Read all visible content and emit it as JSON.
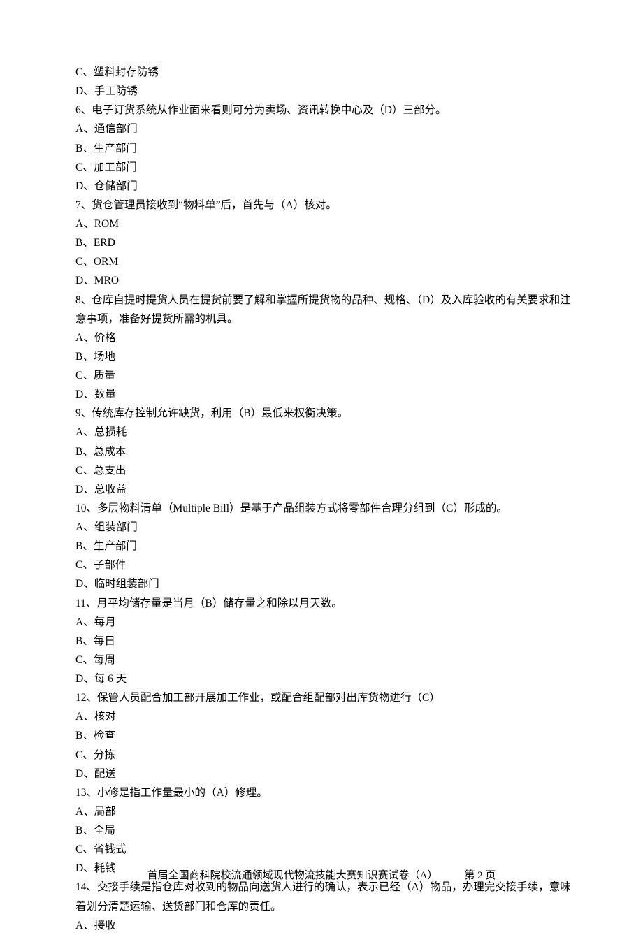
{
  "lines": {
    "l0": "C、塑料封存防锈",
    "l1": "D、手工防锈",
    "l2": "6、电子订货系统从作业面来看则可分为卖场、资讯转换中心及（D）三部分。",
    "l3": "A、通信部门",
    "l4": "B、生产部门",
    "l5": "C、加工部门",
    "l6": "D、仓储部门",
    "l7": "7、货仓管理员接收到“物料单”后，首先与（A）核对。",
    "l8": "A、ROM",
    "l9": "B、ERD",
    "l10": "C、ORM",
    "l11": "D、MRO",
    "l12": "8、仓库自提时提货人员在提货前要了解和掌握所提货物的品种、规格、（D）及入库验收的有关要求和注意事项，准备好提货所需的机具。",
    "l13": "A、价格",
    "l14": "B、场地",
    "l15": "C、质量",
    "l16": "D、数量",
    "l17": "9、传统库存控制允许缺货，利用（B）最低来权衡决策。",
    "l18": "A、总损耗",
    "l19": "B、总成本",
    "l20": "C、总支出",
    "l21": "D、总收益",
    "l22": "10、多层物料清单（Multiple Bill）是基于产品组装方式将零部件合理分组到（C）形成的。",
    "l23": "A、组装部门",
    "l24": "B、生产部门",
    "l25": "C、子部件",
    "l26": "D、临时组装部门",
    "l27": "11、月平均储存量是当月（B）储存量之和除以月天数。",
    "l28": "A、每月",
    "l29": "B、每日",
    "l30": "C、每周",
    "l31": "D、每 6 天",
    "l32": "12、保管人员配合加工部开展加工作业，或配合组配部对出库货物进行（C）",
    "l33": "A、核对",
    "l34": "B、检查",
    "l35": "C、分拣",
    "l36": "D、配送",
    "l37": "13、小修是指工作量最小的（A）修理。",
    "l38": "A、局部",
    "l39": "B、全局",
    "l40": "C、省钱式",
    "l41": "D、耗钱",
    "l42": "14、交接手续是指仓库对收到的物品向送货人进行的确认，表示已经（A）物品，办理完交接手续，意味着划分清楚运输、送货部门和仓库的责任。",
    "l43": "A、接收"
  },
  "footer": {
    "title": "首届全国商科院校流通领域现代物流技能大赛知识赛试卷（A）",
    "page": "第 2 页"
  }
}
